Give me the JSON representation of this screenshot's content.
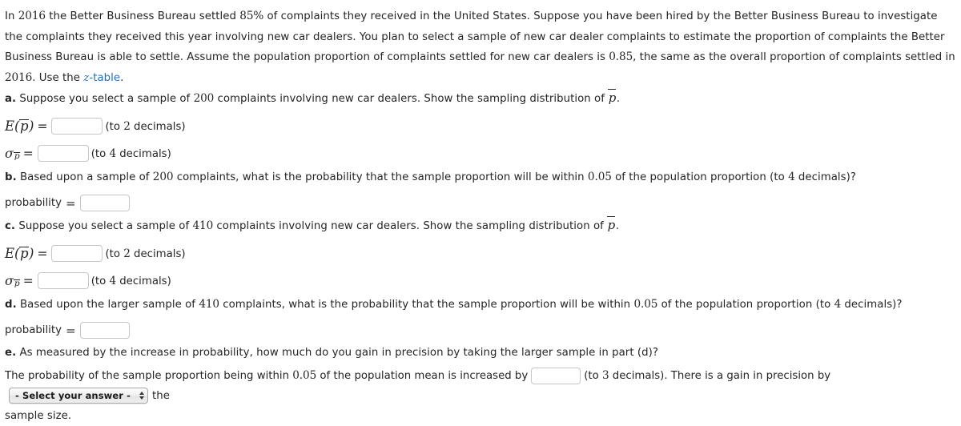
{
  "intro": {
    "s1": "In ",
    "year1": "2016",
    "s2": " the Better Business Bureau settled ",
    "pct": "85%",
    "s3": " of complaints they received in the United States. Suppose you have been hired by the Better Business Bureau to investigate the complaints they received this year involving new car dealers. You plan to select a sample of new car dealer complaints to estimate the proportion of complaints the Better Business Bureau is able to settle. Assume the population proportion of complaints settled for new car dealers is ",
    "p": "0.85",
    "s4": ", the same as the overall proportion of complaints settled in ",
    "year2": "2016",
    "s5": ". Use the ",
    "link_italic": "z",
    "link_rest": "-table",
    "s6": "."
  },
  "parts": {
    "a": {
      "label": "a.",
      "text_before": " Suppose you select a sample of ",
      "n": "200",
      "text_after": " complaints involving new car dealers. Show the sampling distribution of ",
      "pbar": "p",
      "text_end": ".",
      "expectation_label_E": "E",
      "expectation_hint": "(to ",
      "expectation_decimals": "2",
      "expectation_hint_end": " decimals)",
      "sigma_hint": "(to ",
      "sigma_decimals": "4",
      "sigma_hint_end": " decimals)"
    },
    "b": {
      "label": "b.",
      "t1": " Based upon a sample of ",
      "n": "200",
      "t2": " complaints, what is the probability that the sample proportion will be within ",
      "within": "0.05",
      "t3": " of the population proportion (to ",
      "decimals": "4",
      "t4": " decimals)?",
      "prob_label": "probability"
    },
    "c": {
      "label": "c.",
      "text_before": " Suppose you select a sample of ",
      "n": "410",
      "text_after": " complaints involving new car dealers. Show the sampling distribution of ",
      "pbar": "p",
      "text_end": ".",
      "expectation_label_E": "E",
      "expectation_hint": "(to ",
      "expectation_decimals": "2",
      "expectation_hint_end": " decimals)",
      "sigma_hint": "(to ",
      "sigma_decimals": "4",
      "sigma_hint_end": " decimals)"
    },
    "d": {
      "label": "d.",
      "t1": " Based upon the larger sample of ",
      "n": "410",
      "t2": " complaints, what is the probability that the sample proportion will be within ",
      "within": "0.05",
      "t3": " of the population proportion (to ",
      "decimals": "4",
      "t4": " decimals)?",
      "prob_label": "probability"
    },
    "e": {
      "label": "e.",
      "text": " As measured by the increase in probability, how much do you gain in precision by taking the larger sample in part (d)?",
      "f1": "The probability of the sample proportion being within ",
      "within": "0.05",
      "f2": " of the population mean is increased by",
      "f3": "(to ",
      "decimals": "3",
      "f4": " decimals). There is a gain in precision by",
      "select_value": "- Select your answer -",
      "f5": "the",
      "f6": "sample size."
    }
  },
  "inputs": {
    "value": "",
    "placeholder": ""
  },
  "colors": {
    "text": "#252525",
    "link": "#1f6fc4",
    "input_border": "#c6c6c6",
    "select_border": "#a9a9a9"
  }
}
